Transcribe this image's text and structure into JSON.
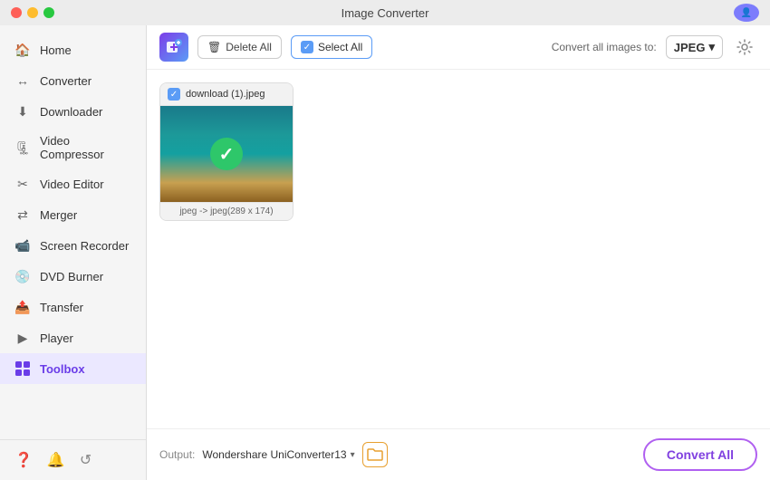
{
  "window": {
    "title": "Image Converter"
  },
  "titlebar": {
    "close_label": "",
    "min_label": "",
    "max_label": "",
    "user_icon": "U"
  },
  "sidebar": {
    "items": [
      {
        "id": "home",
        "label": "Home",
        "icon": "🏠"
      },
      {
        "id": "converter",
        "label": "Converter",
        "icon": "↔️"
      },
      {
        "id": "downloader",
        "label": "Downloader",
        "icon": "⬇️"
      },
      {
        "id": "video-compressor",
        "label": "Video Compressor",
        "icon": "🗜️"
      },
      {
        "id": "video-editor",
        "label": "Video Editor",
        "icon": "✂️"
      },
      {
        "id": "merger",
        "label": "Merger",
        "icon": "🔀"
      },
      {
        "id": "screen-recorder",
        "label": "Screen Recorder",
        "icon": "📹"
      },
      {
        "id": "dvd-burner",
        "label": "DVD Burner",
        "icon": "💿"
      },
      {
        "id": "transfer",
        "label": "Transfer",
        "icon": "📤"
      },
      {
        "id": "player",
        "label": "Player",
        "icon": "▶️"
      },
      {
        "id": "toolbox",
        "label": "Toolbox",
        "icon": "⚙️",
        "active": true
      }
    ],
    "bottom_icons": [
      "question-icon",
      "bell-icon",
      "refresh-icon"
    ]
  },
  "toolbar": {
    "delete_all_label": "Delete All",
    "select_all_label": "Select All",
    "convert_label": "Convert all images to:",
    "format_value": "JPEG",
    "format_arrow": "▾"
  },
  "files": [
    {
      "name": "download (1).jpeg",
      "info": "jpeg -> jpeg(289 x 174)",
      "checked": true
    }
  ],
  "footer": {
    "output_label": "Output:",
    "output_folder": "Wondershare UniConverter13",
    "folder_icon": "📁",
    "convert_all_label": "Convert All"
  }
}
